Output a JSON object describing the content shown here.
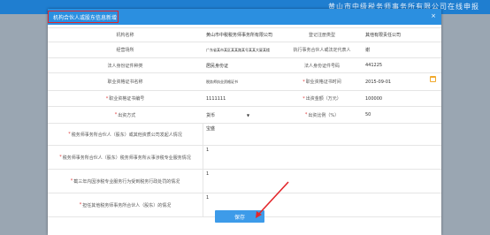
{
  "background": {
    "title": "黄山市中级税务师事务所有限公司在线申报"
  },
  "modal": {
    "title": "机构合伙人或股东信息新增",
    "close_label": "×",
    "rows": {
      "r0": {
        "left_value": "",
        "right_value": ""
      },
      "institution_name": {
        "label": "机构名称",
        "value": "黄山市中税税务师事务所有限公司"
      },
      "registration_type": {
        "label": "登记注册类型",
        "value": "其他有限责任公司"
      },
      "business_address": {
        "label": "经营场所",
        "value": "广东省某市某区某某路某号某某大厦某楼"
      },
      "exec_partner": {
        "label": "执行事务合伙人或法定代表人",
        "value": "谢"
      },
      "id_type": {
        "label": "法人身份证件种类",
        "value": "居民身份证"
      },
      "id_number": {
        "label": "法人身份证件号码",
        "value": "441225"
      },
      "qual_cert_name": {
        "label": "职业资格证书名称",
        "value": "税务师执业资格证书"
      },
      "qual_cert_date": {
        "label": "职业资格证书时间",
        "value": "2015-09-01"
      },
      "qual_cert_number": {
        "label": "职业资格证书编号",
        "value": "1111111"
      },
      "capital_amount": {
        "label": "出资金额（万元）",
        "value": "100000"
      },
      "capital_method": {
        "label": "出资方式",
        "value": "货币"
      },
      "capital_ratio": {
        "label": "出资比例（%）",
        "value": "50"
      },
      "q1": {
        "label": "税务师事务所合伙人（股东）或其他资质公司发起人情况",
        "value": "宝盛"
      },
      "q2": {
        "label": "税务师事务所合伙人（股东）税务师事务所从事涉税专业服务情况",
        "value": "1"
      },
      "q3": {
        "label": "截三年内因涉税专业服务行为受到税务行政处罚的情况",
        "value": "1"
      },
      "q4": {
        "label": "担任其他税务师事务所合伙人（股东）的情况",
        "value": "1"
      }
    },
    "save_label": "保存"
  },
  "colors": {
    "header_blue": "#2b8fe0",
    "bg_blue": "#1f7ed0",
    "highlight_red": "#e3262b",
    "required_red": "#e03a3a",
    "save_blue": "#3d9be9"
  }
}
